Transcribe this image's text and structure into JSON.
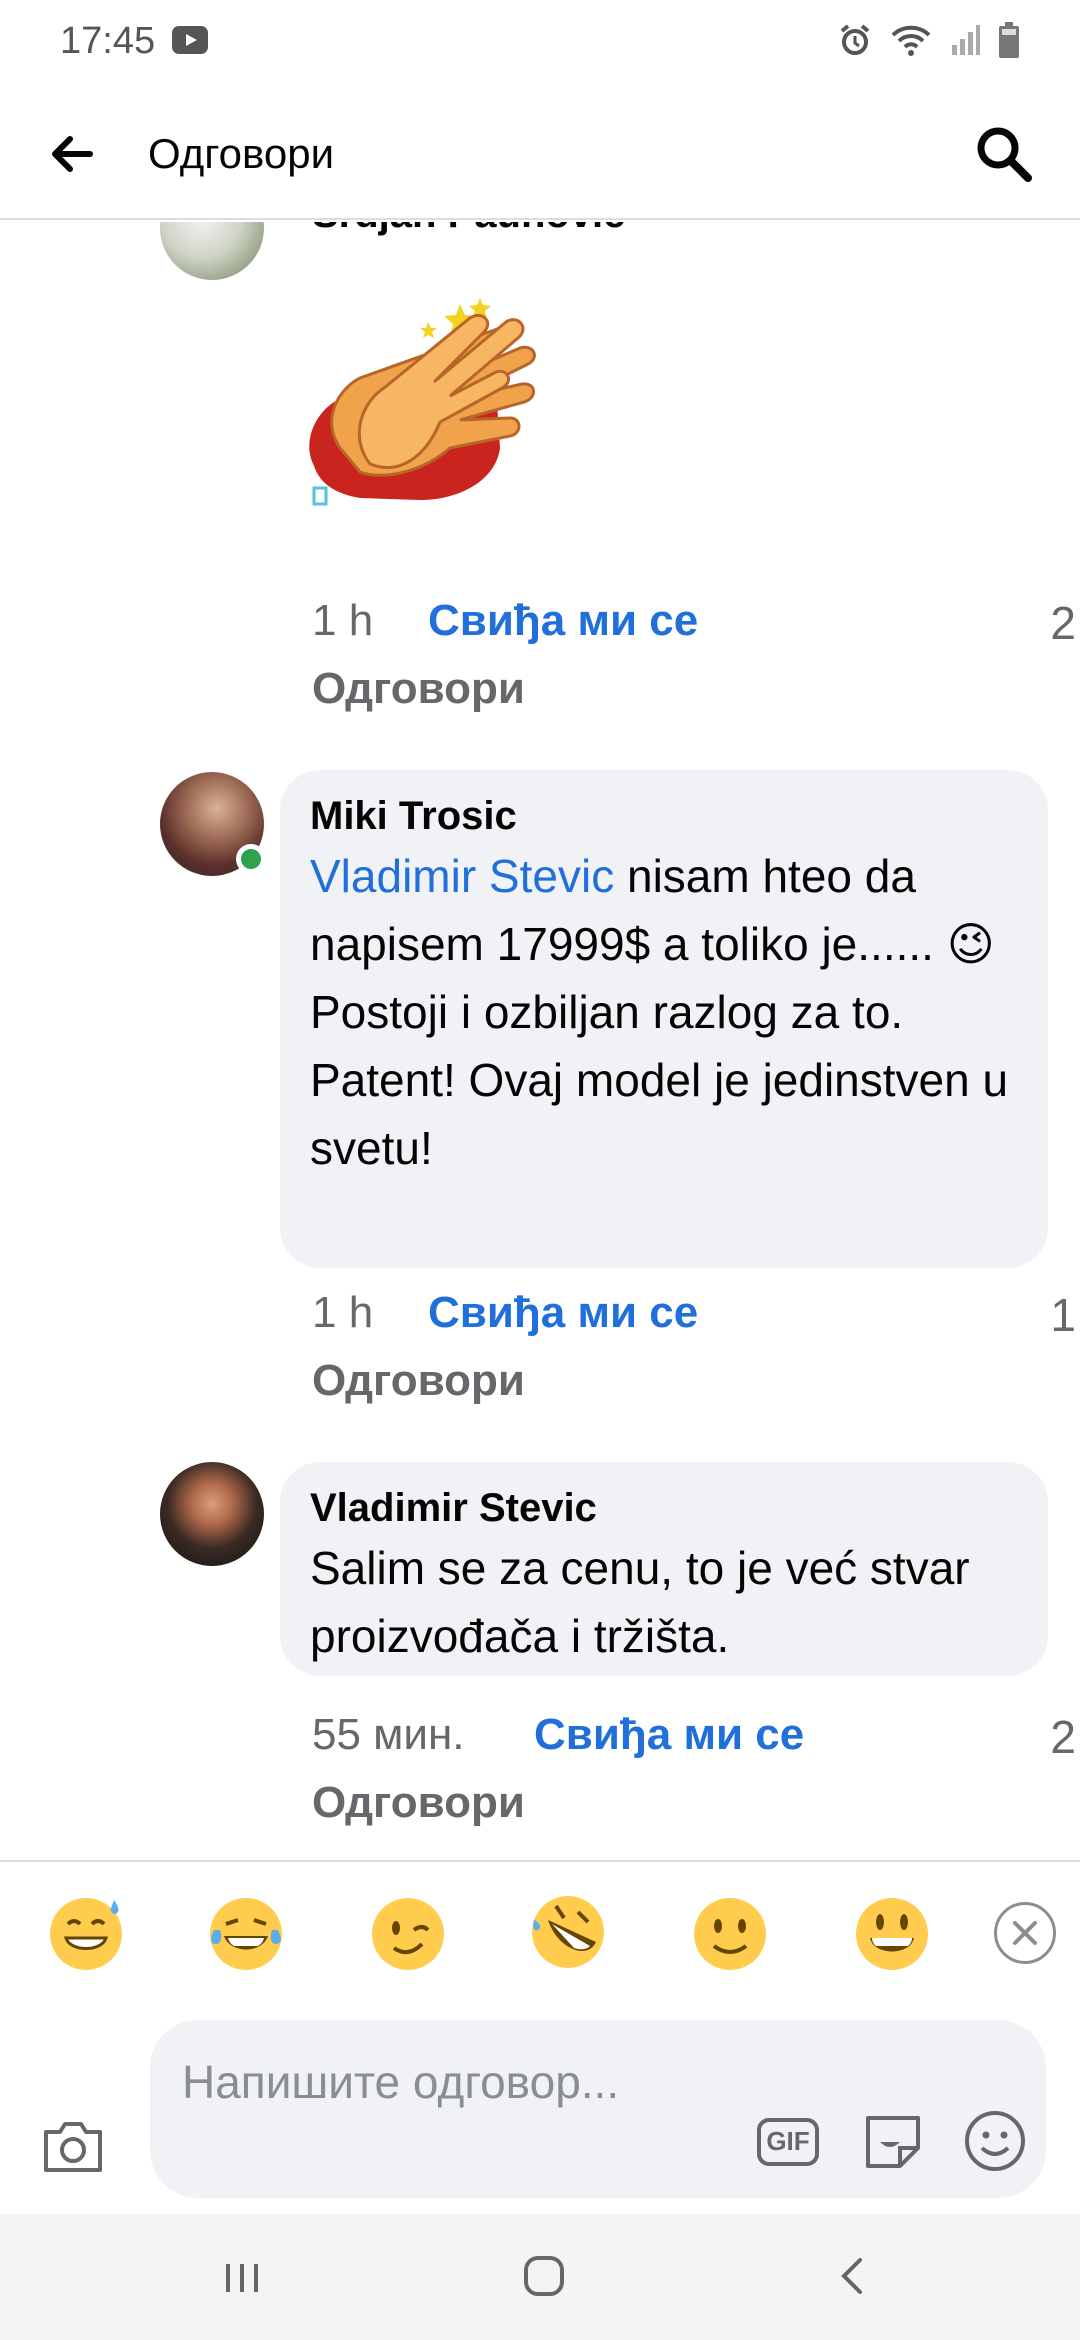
{
  "status_bar": {
    "time": "17:45",
    "icons": [
      "youtube-icon",
      "alarm-icon",
      "wifi-icon",
      "signal-icon",
      "battery-icon"
    ]
  },
  "app_bar": {
    "title": "Одговори",
    "back_icon": "back-arrow-icon",
    "search_icon": "search-icon"
  },
  "comments": [
    {
      "author": "Srdjan Paunović",
      "sticker": "clapping-hands-sticker",
      "time": "1 h",
      "like_label": "Свиђа ми се",
      "reply_label": "Одговори",
      "likes": "2"
    },
    {
      "author": "Miki Trosic",
      "online": true,
      "mention": "Vladimir Stevic",
      "text": " nisam hteo da napisem 17999$ a toliko je...... 😉\nPostoji i ozbiljan razlog za to. Patent! Ovaj model je jedinstven u svetu!",
      "time": "1 h",
      "like_label": "Свиђа ми се",
      "reply_label": "Одговори",
      "likes": "1"
    },
    {
      "author": "Vladimir Stevic",
      "text": "Salim se za cenu, to je već stvar proizvođača i tržišta.",
      "time": "55 мин.",
      "like_label": "Свиђа ми се",
      "reply_label": "Одговори",
      "likes": "2"
    }
  ],
  "quick_reactions": [
    "😅",
    "😂",
    "😉",
    "🤣",
    "🙂",
    "😃"
  ],
  "composer": {
    "placeholder": "Напишите одговор...",
    "gif_label": "GIF"
  },
  "colors": {
    "accent": "#216fdb",
    "like_blue": "#1877f2",
    "bubble_bg": "#f0f2f5",
    "secondary_text": "#65676b",
    "online_green": "#31a24c"
  }
}
